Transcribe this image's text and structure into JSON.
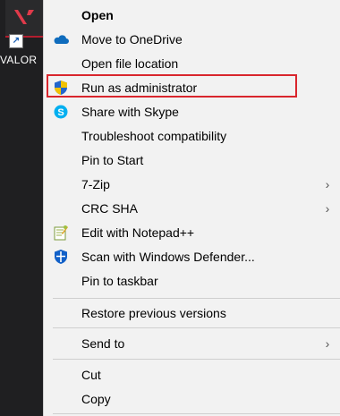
{
  "desktop": {
    "app_label": "VALOR",
    "icon": "valorant-app-icon",
    "shortcut_icon": "shortcut-arrow-icon"
  },
  "menu": {
    "items": [
      {
        "label": "Open",
        "bold": true,
        "icon": null,
        "submenu": false
      },
      {
        "label": "Move to OneDrive",
        "icon": "onedrive-cloud-icon",
        "submenu": false
      },
      {
        "label": "Open file location",
        "icon": null,
        "submenu": false
      },
      {
        "label": "Run as administrator",
        "icon": "uac-shield-icon",
        "submenu": false,
        "highlighted": true
      },
      {
        "label": "Share with Skype",
        "icon": "skype-icon",
        "submenu": false
      },
      {
        "label": "Troubleshoot compatibility",
        "icon": null,
        "submenu": false
      },
      {
        "label": "Pin to Start",
        "icon": null,
        "submenu": false
      },
      {
        "label": "7-Zip",
        "icon": null,
        "submenu": true
      },
      {
        "label": "CRC SHA",
        "icon": null,
        "submenu": true
      },
      {
        "label": "Edit with Notepad++",
        "icon": "notepadpp-icon",
        "submenu": false
      },
      {
        "label": "Scan with Windows Defender...",
        "icon": "windows-defender-icon",
        "submenu": false
      },
      {
        "label": "Pin to taskbar",
        "icon": null,
        "submenu": false
      },
      {
        "label": "Restore previous versions",
        "icon": null,
        "submenu": false
      },
      {
        "label": "Send to",
        "icon": null,
        "submenu": true
      },
      {
        "label": "Cut",
        "icon": null,
        "submenu": false
      },
      {
        "label": "Copy",
        "icon": null,
        "submenu": false
      }
    ],
    "submenu_arrow": "›",
    "highlight_color": "#d9262d"
  },
  "colors": {
    "menu_bg": "#f2f2f2",
    "desktop_bg": "#1f1f21",
    "onedrive_blue": "#0f6cbd",
    "skype_blue": "#00aff0",
    "shield_blue": "#2266cc",
    "shield_yellow": "#f2c200"
  }
}
